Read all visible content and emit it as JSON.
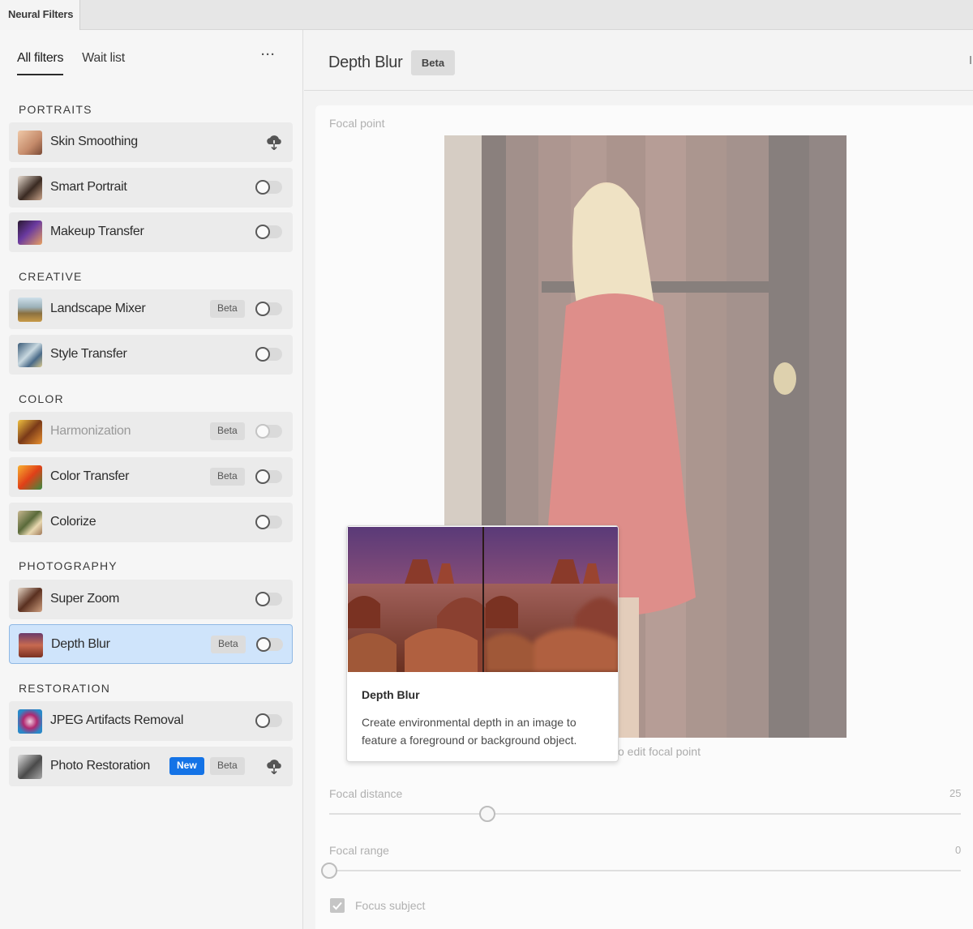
{
  "window_tab": "Neural Filters",
  "sidebar": {
    "tabs": [
      "All filters",
      "Wait list"
    ],
    "more_label": "···",
    "categories": [
      "PORTRAITS",
      "CREATIVE",
      "COLOR",
      "PHOTOGRAPHY",
      "RESTORATION"
    ],
    "filters": [
      {
        "label": "Skin Smoothing",
        "control": "cloud",
        "badges": []
      },
      {
        "label": "Smart Portrait",
        "control": "toggle",
        "badges": []
      },
      {
        "label": "Makeup Transfer",
        "control": "toggle",
        "badges": []
      },
      {
        "label": "Landscape Mixer",
        "control": "toggle",
        "badges": [
          "Beta"
        ]
      },
      {
        "label": "Style Transfer",
        "control": "toggle",
        "badges": []
      },
      {
        "label": "Harmonization",
        "control": "toggle",
        "badges": [
          "Beta"
        ],
        "disabled": true
      },
      {
        "label": "Color Transfer",
        "control": "toggle",
        "badges": [
          "Beta"
        ]
      },
      {
        "label": "Colorize",
        "control": "toggle",
        "badges": []
      },
      {
        "label": "Super Zoom",
        "control": "toggle",
        "badges": []
      },
      {
        "label": "Depth Blur",
        "control": "toggle",
        "badges": [
          "Beta"
        ],
        "selected": true
      },
      {
        "label": "JPEG Artifacts Removal",
        "control": "toggle",
        "badges": []
      },
      {
        "label": "Photo Restoration",
        "control": "cloud",
        "badges": [
          "New",
          "Beta"
        ]
      }
    ]
  },
  "main": {
    "title": "Depth Blur",
    "badge": "Beta",
    "focal_point_label": "Focal point",
    "focal_point_hint": "o edit focal point",
    "focal_distance_label": "Focal distance",
    "focal_distance_value": "25",
    "focal_distance_fraction": 0.25,
    "focal_range_label": "Focal range",
    "focal_range_value": "0",
    "focal_range_fraction": 0,
    "focus_subject_label": "Focus subject",
    "focus_subject_checked": true
  },
  "tooltip": {
    "title": "Depth Blur",
    "description": "Create environmental depth in an image to feature a foreground or background object."
  },
  "colors": {
    "accent_blue": "#1473e6",
    "selected_row": "#cfe4fb"
  }
}
